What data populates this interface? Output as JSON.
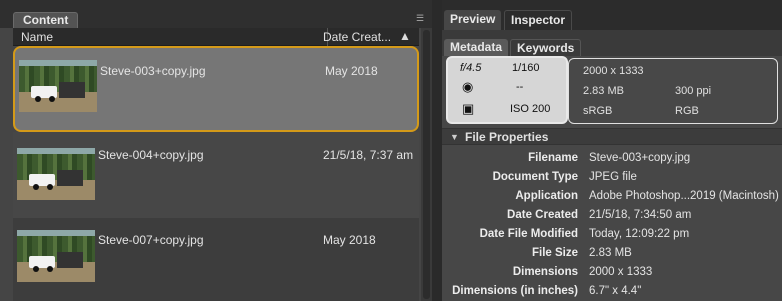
{
  "content_panel": {
    "tab_label": "Content",
    "columns": {
      "name": "Name",
      "date": "Date Creat..."
    },
    "files": [
      {
        "name": "Steve-003+copy.jpg",
        "date": "May 2018",
        "selected": true
      },
      {
        "name": "Steve-004+copy.jpg",
        "date": "21/5/18, 7:37 am",
        "selected": false
      },
      {
        "name": "Steve-007+copy.jpg",
        "date": "May 2018",
        "selected": false
      }
    ]
  },
  "right_panel": {
    "tabs": {
      "preview": "Preview",
      "inspector": "Inspector"
    },
    "subtabs": {
      "metadata": "Metadata",
      "keywords": "Keywords"
    },
    "camera": {
      "aperture": "f/4.5",
      "shutter": "1/160",
      "metering": "--",
      "iso": "ISO 200"
    },
    "image_info": {
      "dimensions": "2000 x 1333",
      "size": "2.83 MB",
      "resolution": "300 ppi",
      "profile": "sRGB",
      "mode": "RGB"
    },
    "file_properties": {
      "title": "File Properties",
      "rows": [
        {
          "key": "Filename",
          "value": "Steve-003+copy.jpg"
        },
        {
          "key": "Document Type",
          "value": "JPEG file"
        },
        {
          "key": "Application",
          "value": "Adobe Photoshop...2019 (Macintosh)"
        },
        {
          "key": "Date Created",
          "value": "21/5/18, 7:34:50 am"
        },
        {
          "key": "Date File Modified",
          "value": "Today, 12:09:22 pm"
        },
        {
          "key": "File Size",
          "value": "2.83 MB"
        },
        {
          "key": "Dimensions",
          "value": "2000 x 1333"
        },
        {
          "key": "Dimensions (in inches)",
          "value": "6.7\" x 4.4\""
        }
      ]
    }
  }
}
